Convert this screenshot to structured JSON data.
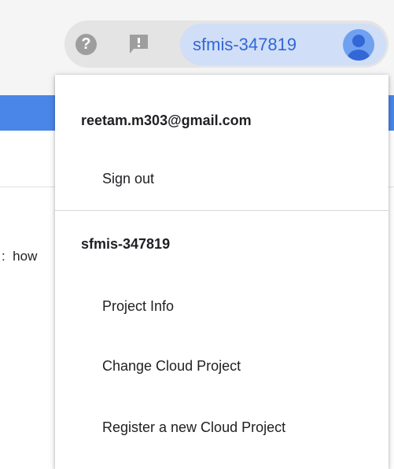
{
  "header": {
    "help_icon_glyph": "?",
    "feedback_icon_glyph": "!",
    "project_chip_label": "sfmis-347819"
  },
  "background": {
    "partial_text": ":  how"
  },
  "account_menu": {
    "email": "reetam.m303@gmail.com",
    "sign_out": "Sign out",
    "project_section_title": "sfmis-347819",
    "items": [
      {
        "label": "Project Info"
      },
      {
        "label": "Change Cloud Project"
      },
      {
        "label": "Register a new Cloud Project"
      }
    ]
  },
  "colors": {
    "accent_blue": "#4a86e8",
    "chip_background": "#d0def7",
    "chip_text": "#3367d6",
    "icon_gray": "#9e9e9e",
    "topbar_background": "#f5f5f5"
  },
  "icons": {
    "help": "help-circle-icon",
    "feedback": "feedback-icon",
    "avatar": "account-avatar-icon"
  }
}
